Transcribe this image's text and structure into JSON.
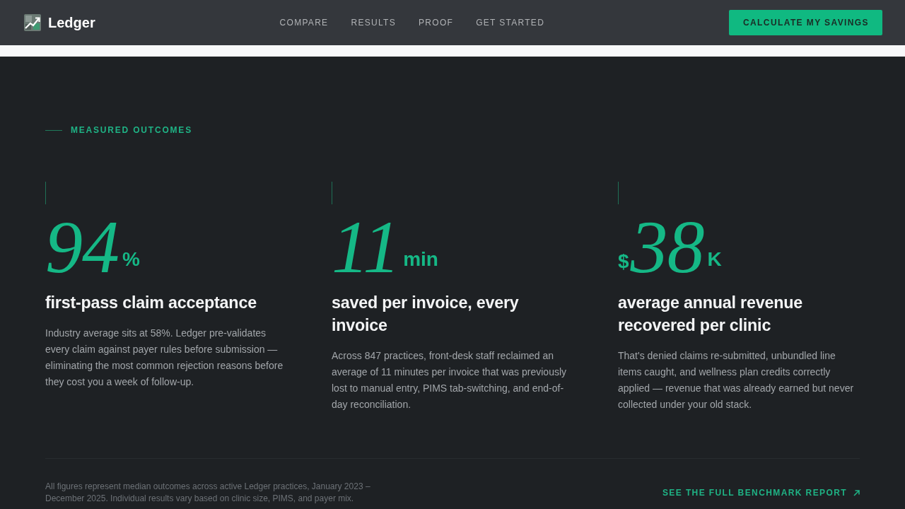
{
  "navbar": {
    "brand": "Ledger",
    "links": [
      "COMPARE",
      "RESULTS",
      "PROOF",
      "GET STARTED"
    ],
    "cta": "CALCULATE MY SAVINGS"
  },
  "outcomes": {
    "eyebrow": "MEASURED OUTCOMES",
    "stats": [
      {
        "value": "94",
        "suffix": "%",
        "title": "first-pass claim acceptance",
        "description": "Industry average sits at 58%. Ledger pre-validates every claim against payer rules before submission — eliminating the most common rejection reasons before they cost you a week of follow-up."
      },
      {
        "value": "11",
        "suffix": "min",
        "title": "saved per invoice, every invoice",
        "description": "Across 847 practices, front-desk staff reclaimed an average of 11 minutes per invoice that was previously lost to manual entry, PIMS tab-switching, and end-of-day reconciliation."
      },
      {
        "prefix": "$",
        "value": "38",
        "suffix": "K",
        "title": "average annual revenue recovered per clinic",
        "description": "That's denied claims re-submitted, unbundled line items caught, and wellness plan credits correctly applied — revenue that was already earned but never collected under your old stack."
      }
    ],
    "footnote": "All figures represent median outcomes across active Ledger practices, January 2023 – December 2025. Individual results vary based on clinic size, PIMS, and payer mix.",
    "report_link": "SEE THE FULL BENCHMARK REPORT"
  }
}
